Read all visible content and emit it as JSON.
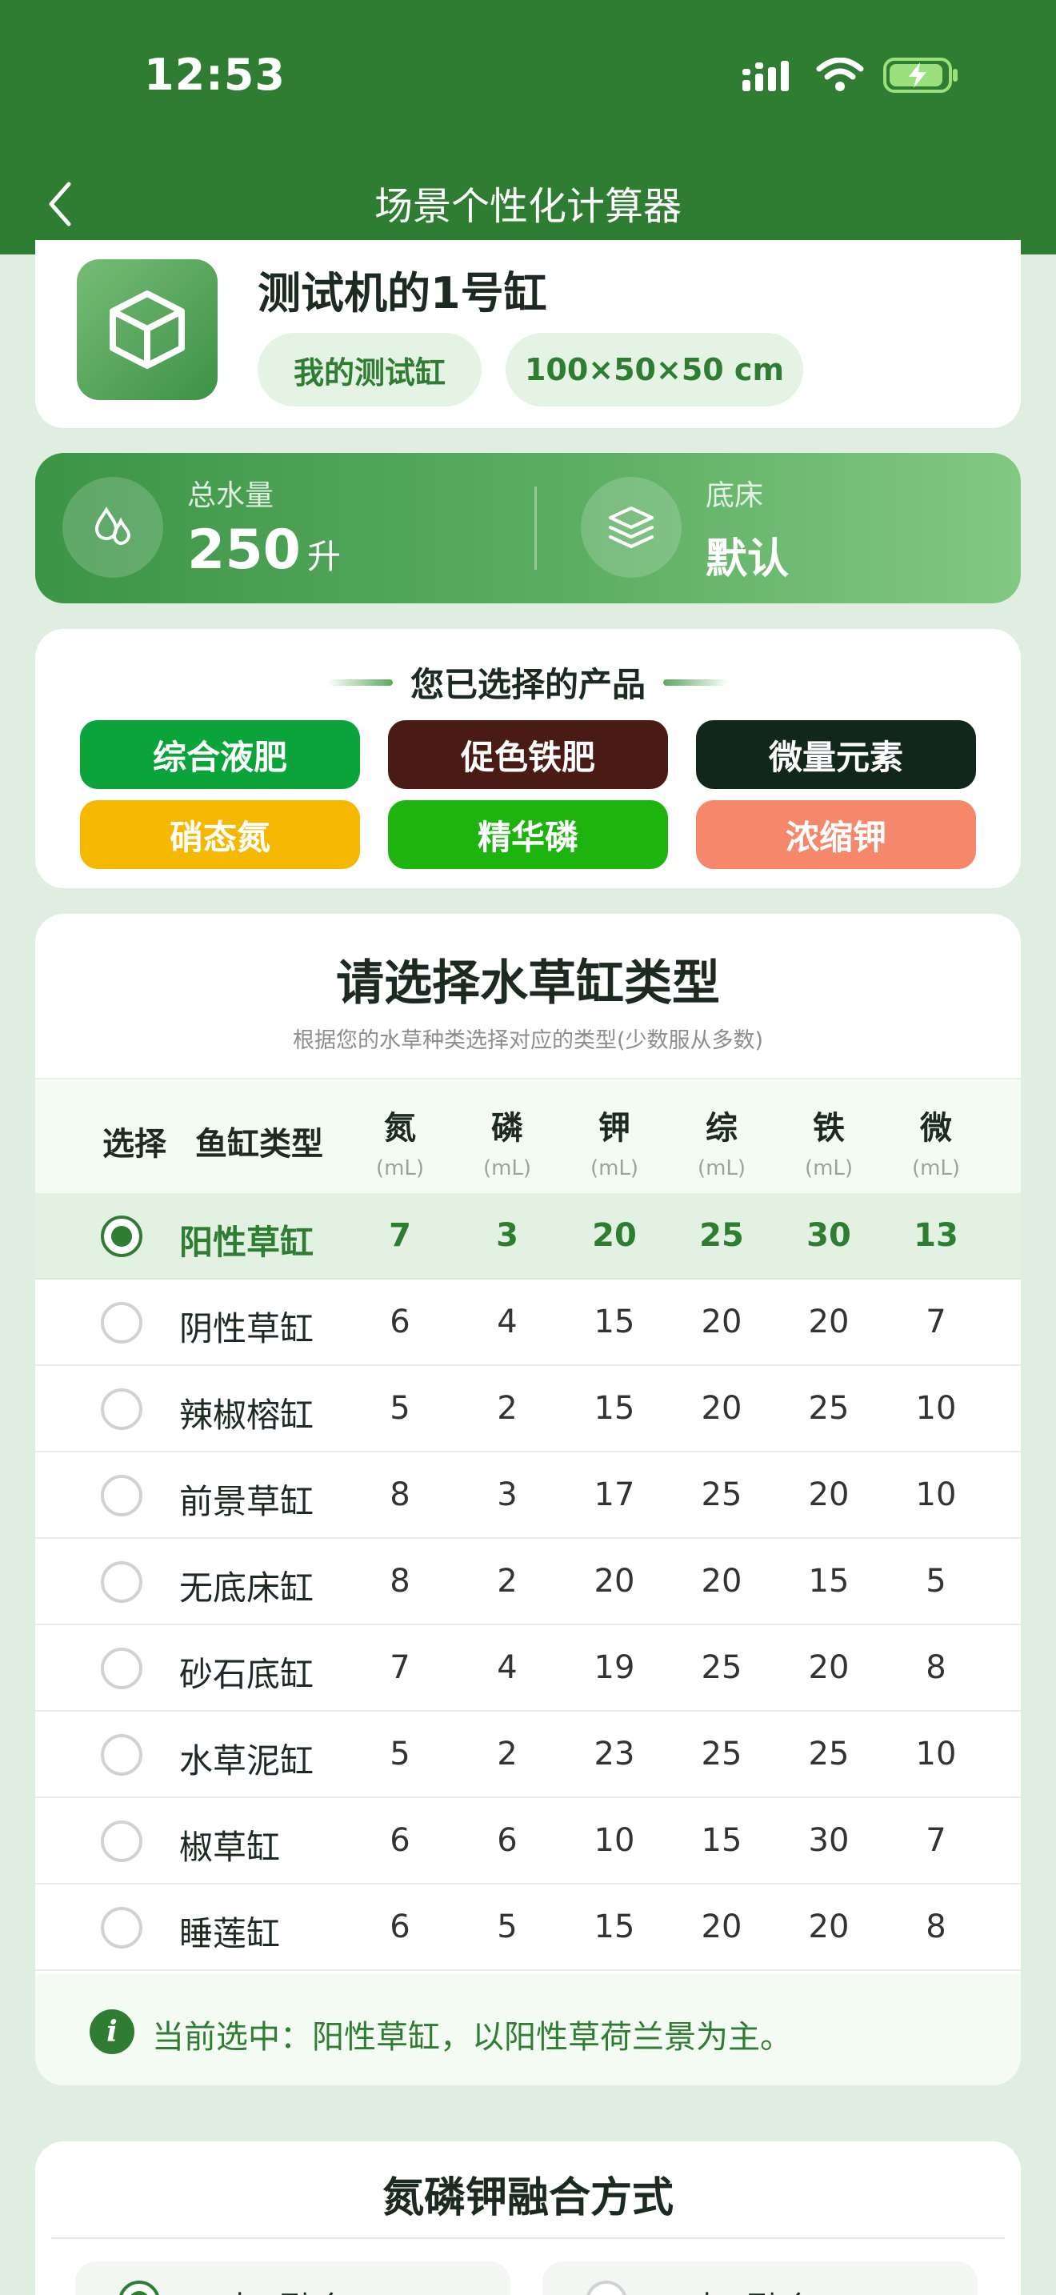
{
  "status": {
    "time": "12:53"
  },
  "nav": {
    "title": "场景个性化计算器"
  },
  "tank": {
    "name": "测试机的1号缸",
    "tags": [
      "我的测试缸",
      "100×50×50 cm"
    ]
  },
  "water": {
    "volume_label": "总水量",
    "volume_value": "250",
    "volume_unit": "升",
    "substrate_label": "底床",
    "substrate_value": "默认"
  },
  "products": {
    "title": "您已选择的产品",
    "items": [
      {
        "label": "综合液肥",
        "color": "#0aa43a"
      },
      {
        "label": "促色铁肥",
        "color": "#4a1a14"
      },
      {
        "label": "微量元素",
        "color": "#12271b"
      },
      {
        "label": "硝态氮",
        "color": "#f5b800"
      },
      {
        "label": "精华磷",
        "color": "#1eb40f"
      },
      {
        "label": "浓缩钾",
        "color": "#f5886b"
      }
    ]
  },
  "tank_type": {
    "title": "请选择水草缸类型",
    "subtitle": "根据您的水草种类选择对应的类型(少数服从多数)",
    "headers": {
      "select": "选择",
      "type": "鱼缸类型",
      "cols": [
        {
          "name": "氮",
          "unit": "(mL)"
        },
        {
          "name": "磷",
          "unit": "(mL)"
        },
        {
          "name": "钾",
          "unit": "(mL)"
        },
        {
          "name": "综",
          "unit": "(mL)"
        },
        {
          "name": "铁",
          "unit": "(mL)"
        },
        {
          "name": "微",
          "unit": "(mL)"
        }
      ]
    },
    "rows": [
      {
        "name": "阳性草缸",
        "selected": true,
        "values": [
          "7",
          "3",
          "20",
          "25",
          "30",
          "13"
        ]
      },
      {
        "name": "阴性草缸",
        "selected": false,
        "values": [
          "6",
          "4",
          "15",
          "20",
          "20",
          "7"
        ]
      },
      {
        "name": "辣椒榕缸",
        "selected": false,
        "values": [
          "5",
          "2",
          "15",
          "20",
          "25",
          "10"
        ]
      },
      {
        "name": "前景草缸",
        "selected": false,
        "values": [
          "8",
          "3",
          "17",
          "25",
          "20",
          "10"
        ]
      },
      {
        "name": "无底床缸",
        "selected": false,
        "values": [
          "8",
          "2",
          "20",
          "20",
          "15",
          "5"
        ]
      },
      {
        "name": "砂石底缸",
        "selected": false,
        "values": [
          "7",
          "4",
          "19",
          "25",
          "20",
          "8"
        ]
      },
      {
        "name": "水草泥缸",
        "selected": false,
        "values": [
          "5",
          "2",
          "23",
          "25",
          "25",
          "10"
        ]
      },
      {
        "name": "椒草缸",
        "selected": false,
        "values": [
          "6",
          "6",
          "10",
          "15",
          "30",
          "7"
        ]
      },
      {
        "name": "睡莲缸",
        "selected": false,
        "values": [
          "6",
          "5",
          "15",
          "20",
          "20",
          "8"
        ]
      }
    ],
    "note": "当前选中：阳性草缸，以阳性草荷兰景为主。",
    "note_icon": "i"
  },
  "npk": {
    "title": "氮磷钾融合方式",
    "options": [
      {
        "label": "三对三融合",
        "selected": true
      },
      {
        "label": "三对一融合",
        "selected": false
      }
    ]
  },
  "theme": {
    "primary": "#2f7d32",
    "background": "#dfeee1"
  }
}
